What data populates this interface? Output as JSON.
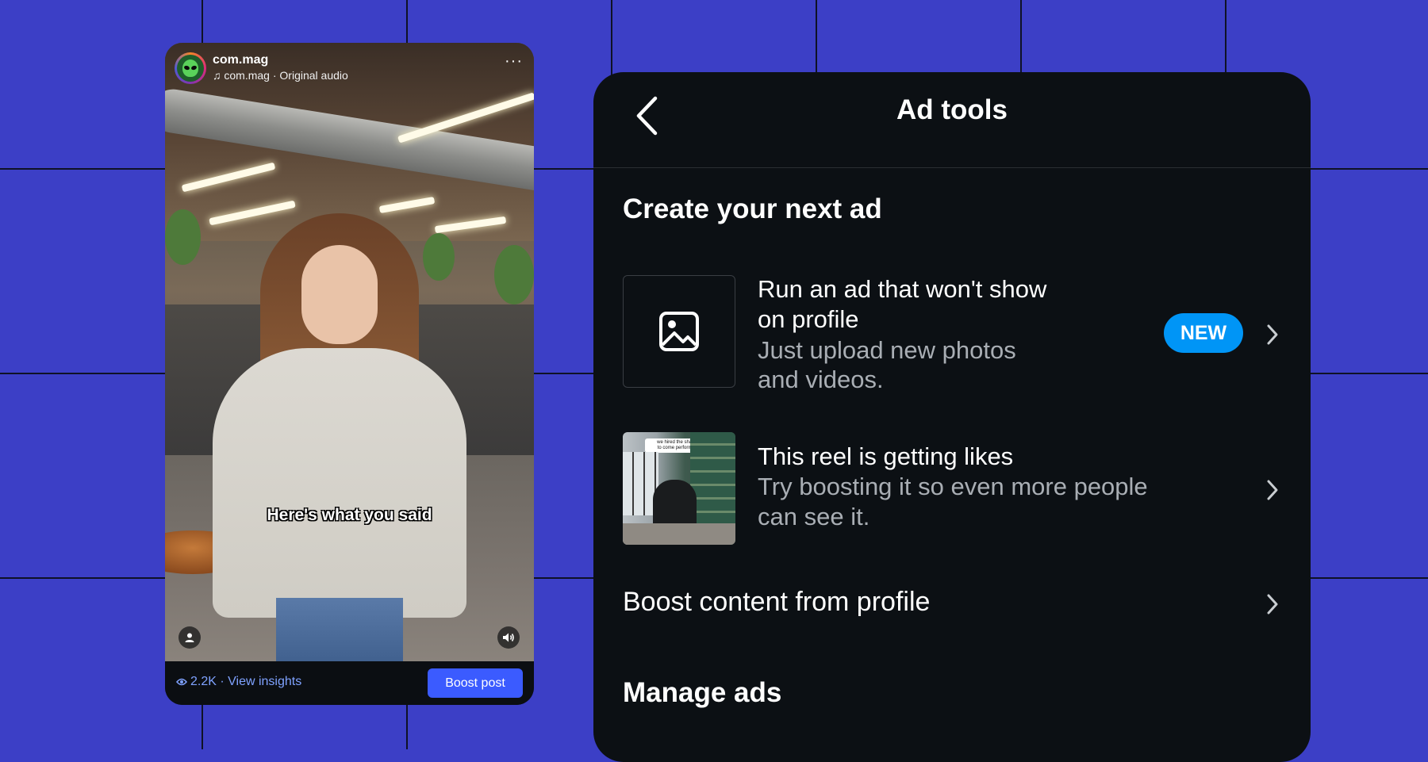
{
  "reel": {
    "username": "com.mag",
    "audio": "com.mag · Original audio",
    "caption": "Here's what you said",
    "views": "2.2K · View insights",
    "boost_label": "Boost post",
    "more": "···"
  },
  "ad_tools": {
    "title": "Ad tools",
    "create_section": "Create your next ad",
    "rows": [
      {
        "title_line1": "Run an ad that won't show",
        "title_line2": "on profile",
        "sub_line1": "Just upload new photos",
        "sub_line2": "and videos.",
        "badge": "NEW",
        "thumb": "image-icon"
      },
      {
        "title_line1": "This reel is getting likes",
        "sub_line1": "Try boosting it so even more people",
        "sub_line2": "can see it.",
        "thumb_caption_line1": "we hired the shadow baddies",
        "thumb_caption_line2": "to come perform at our office"
      }
    ],
    "boost_profile": "Boost content from profile",
    "manage_section": "Manage ads"
  },
  "colors": {
    "background": "#3c3fc6",
    "panel": "#0c1014",
    "accent_blue": "#0095f6",
    "boost_button": "#3b5bff",
    "insights_text": "#7fa2ff"
  }
}
